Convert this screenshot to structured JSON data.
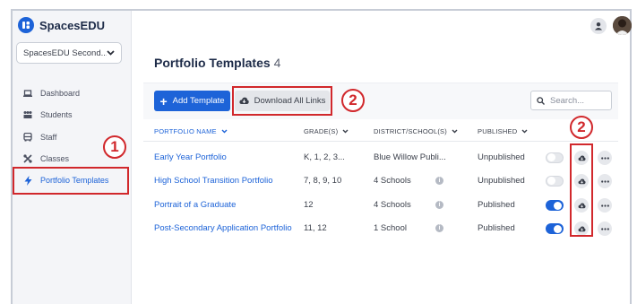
{
  "brand": {
    "name": "SpacesEDU"
  },
  "school_select": {
    "value": "SpacesEDU Second..."
  },
  "nav": [
    {
      "label": "Dashboard",
      "icon": "laptop-icon"
    },
    {
      "label": "Students",
      "icon": "students-icon"
    },
    {
      "label": "Staff",
      "icon": "bus-icon"
    },
    {
      "label": "Classes",
      "icon": "classes-icon"
    },
    {
      "label": "Portfolio Templates",
      "icon": "bolt-icon",
      "active": true
    }
  ],
  "page": {
    "title": "Portfolio Templates",
    "count": "4"
  },
  "toolbar": {
    "add_label": "Add Template",
    "download_label": "Download All Links",
    "search_placeholder": "Search..."
  },
  "table": {
    "headers": [
      "PORTFOLIO NAME",
      "GRADE(S)",
      "DISTRICT/SCHOOL(S)",
      "PUBLISHED"
    ],
    "rows": [
      {
        "name": "Early Year Portfolio",
        "grades": "K, 1, 2, 3...",
        "schools": "Blue Willow Publi...",
        "schools_info": false,
        "status": "Unpublished",
        "published": false
      },
      {
        "name": "High School Transition Portfolio",
        "grades": "7, 8, 9, 10",
        "schools": "4 Schools",
        "schools_info": true,
        "status": "Unpublished",
        "published": false
      },
      {
        "name": "Portrait of a Graduate",
        "grades": "12",
        "schools": "4 Schools",
        "schools_info": true,
        "status": "Published",
        "published": true
      },
      {
        "name": "Post-Secondary Application Portfolio",
        "grades": "11, 12",
        "schools": "1 School",
        "schools_info": true,
        "status": "Published",
        "published": true
      }
    ]
  },
  "callouts": {
    "one": "1",
    "two": "2"
  },
  "colors": {
    "accent": "#1d63d8",
    "annotation": "#d1282c",
    "sidebar_bg": "#f4f5f8"
  }
}
